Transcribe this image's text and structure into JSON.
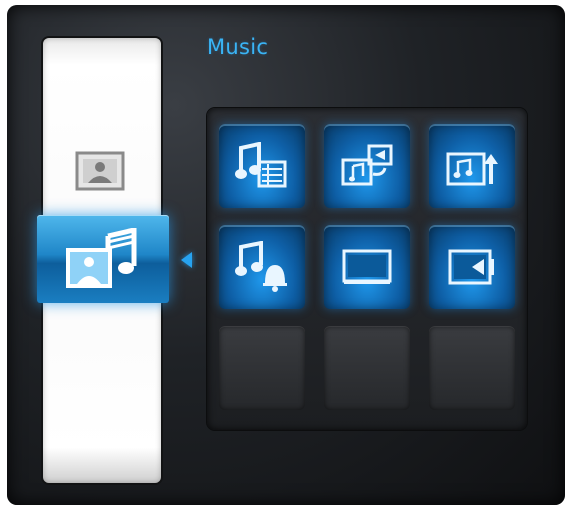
{
  "header": {
    "title": "Music"
  },
  "sidebar": {
    "items": [
      {
        "icon": "photo-icon"
      },
      {
        "icon": "photo-music-icon",
        "selected": true
      }
    ]
  },
  "grid": {
    "cells": [
      {
        "icon": "music-playlist-icon",
        "state": "active"
      },
      {
        "icon": "slideshow-music-icon",
        "state": "active"
      },
      {
        "icon": "music-upload-icon",
        "state": "active"
      },
      {
        "icon": "music-alarm-icon",
        "state": "active"
      },
      {
        "icon": "screen-icon",
        "state": "active"
      },
      {
        "icon": "video-icon",
        "state": "active"
      },
      {
        "icon": "",
        "state": "empty"
      },
      {
        "icon": "",
        "state": "empty"
      },
      {
        "icon": "",
        "state": "empty"
      }
    ]
  },
  "colors": {
    "accent": "#3ab4f5",
    "tile_blue": "#1f86c8",
    "background": "#1f2226",
    "strip": "#fafafa"
  }
}
